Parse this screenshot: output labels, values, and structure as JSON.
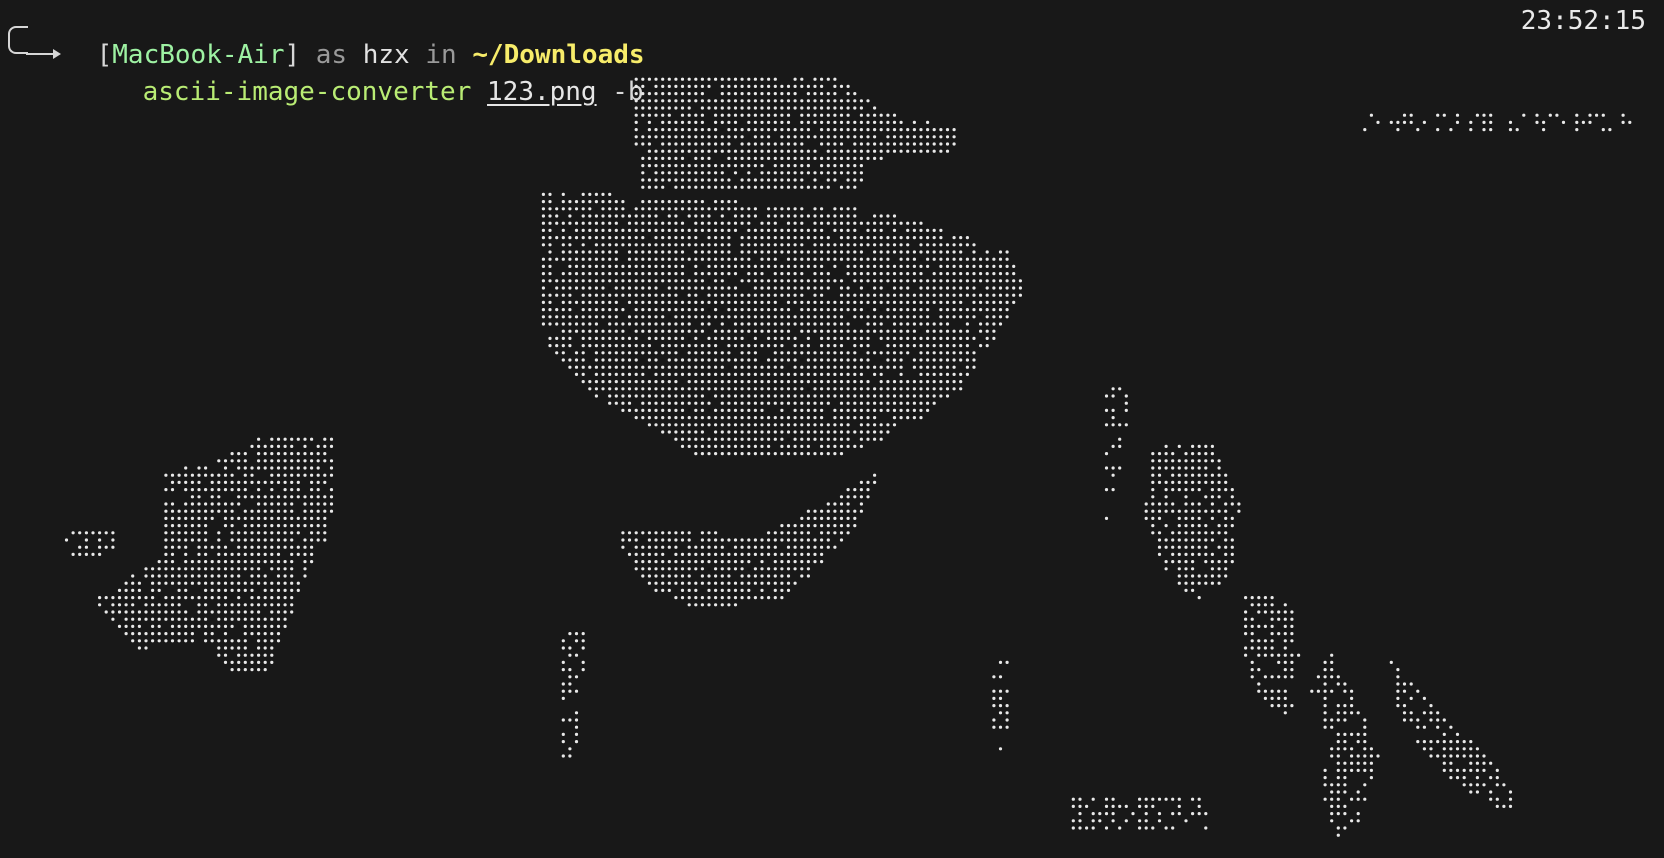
{
  "prompt": {
    "open_bracket": "[",
    "host": "MacBook-Air",
    "close_bracket": "]",
    "as_text": "as",
    "user": "hzx",
    "in_text": "in",
    "directory": "~/Downloads"
  },
  "command": {
    "program": "ascii-image-converter",
    "file_arg": "123.png",
    "flag": "-b"
  },
  "clock": "23:52:15",
  "colors": {
    "background": "#181818",
    "host": "#9ef2a3",
    "directory": "#f7ec6a",
    "command": "#b9ec74",
    "dots": "#e8e8e8"
  },
  "icons": {
    "prompt_corner": "corner-arrow-icon"
  }
}
